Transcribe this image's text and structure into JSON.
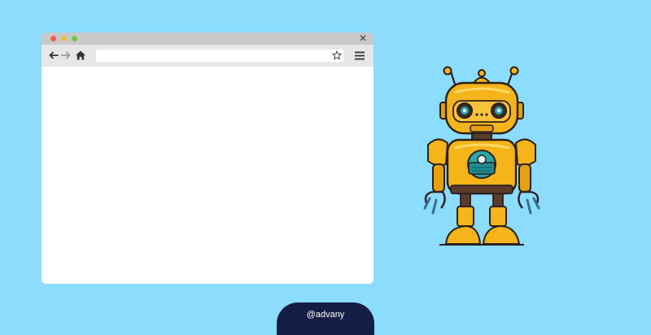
{
  "browser": {
    "window_controls": [
      "close",
      "minimize",
      "maximize"
    ],
    "close_glyph": "✕",
    "icons": {
      "back": "arrow-left-icon",
      "forward": "arrow-right-icon",
      "home": "home-icon",
      "bookmark": "star-icon",
      "menu": "hamburger-menu-icon"
    },
    "url_value": ""
  },
  "illustration": {
    "subject": "robot-illustration"
  },
  "footer": {
    "handle": "@advany"
  },
  "colors": {
    "background": "#8bdcfd",
    "titlebar": "#c9c9c9",
    "toolbar": "#e7e7e7",
    "tab": "#141e45",
    "robot_yellow": "#f4b41a",
    "robot_teal": "#2aa7a8"
  }
}
